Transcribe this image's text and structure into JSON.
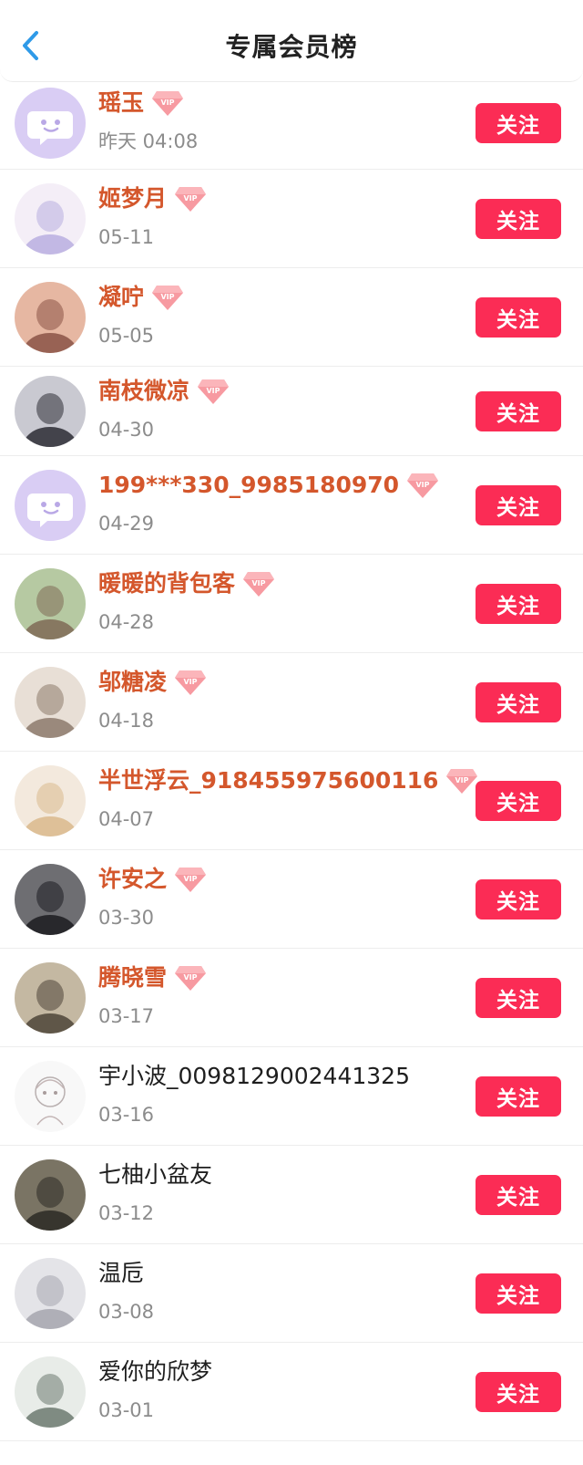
{
  "header": {
    "title": "专属会员榜",
    "back_icon": "chevron-left-icon",
    "back_color": "#2f9ae8"
  },
  "colors": {
    "vip_name": "#d4572c",
    "plain_name": "#1e1e1e",
    "time": "#8c8c8c",
    "follow_button": "#fb2c55"
  },
  "follow_label": "关注",
  "vip_icon_label": "VIP",
  "members": [
    {
      "name": "瑶玉",
      "time": "昨天 04:08",
      "vip": true,
      "avatar": "default-avatar"
    },
    {
      "name": "姬梦月",
      "time": "05-11",
      "vip": true,
      "avatar": "anime-avatar"
    },
    {
      "name": "凝咛",
      "time": "05-05",
      "vip": true,
      "avatar": "photo-avatar"
    },
    {
      "name": "南枝微凉",
      "time": "04-30",
      "vip": true,
      "avatar": "photo-avatar"
    },
    {
      "name": "199***330_9985180970",
      "time": "04-29",
      "vip": true,
      "avatar": "default-avatar"
    },
    {
      "name": "暖暖的背包客",
      "time": "04-28",
      "vip": true,
      "avatar": "photo-avatar"
    },
    {
      "name": "邬糖凌",
      "time": "04-18",
      "vip": true,
      "avatar": "photo-avatar"
    },
    {
      "name": "半世浮云_918455975600116",
      "time": "04-07",
      "vip": true,
      "avatar": "photo-avatar"
    },
    {
      "name": "许安之",
      "time": "03-30",
      "vip": true,
      "avatar": "photo-avatar"
    },
    {
      "name": "腾晓雪",
      "time": "03-17",
      "vip": true,
      "avatar": "photo-avatar"
    },
    {
      "name": "宇小波_0098129002441325",
      "time": "03-16",
      "vip": false,
      "avatar": "sketch-avatar"
    },
    {
      "name": "七柚小盆友",
      "time": "03-12",
      "vip": false,
      "avatar": "photo-avatar"
    },
    {
      "name": "温卮",
      "time": "03-08",
      "vip": false,
      "avatar": "photo-avatar"
    },
    {
      "name": "爱你的欣梦",
      "time": "03-01",
      "vip": false,
      "avatar": "photo-avatar"
    }
  ]
}
